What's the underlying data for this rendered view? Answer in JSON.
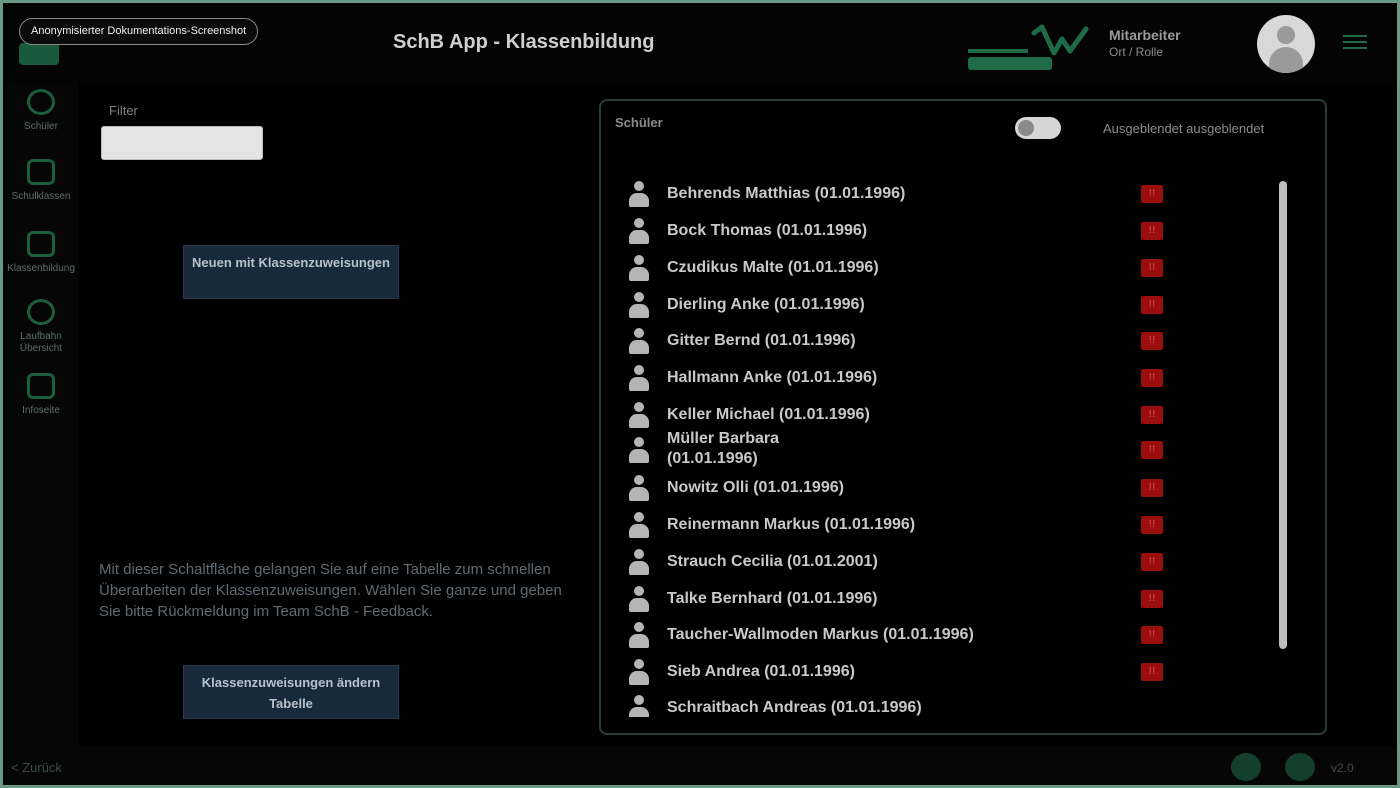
{
  "badge": "Anonymisierter Dokumentations-Screenshot",
  "header": {
    "title": "SchB App - Klassenbildung",
    "user_name": "Mitarbeiter",
    "user_role": "Ort / Rolle"
  },
  "sidebar": {
    "items": [
      {
        "label": "Schüler",
        "icon": "students-icon"
      },
      {
        "label": "Schulklassen",
        "icon": "classes-icon"
      },
      {
        "label": "Klassenbildung",
        "icon": "classbuild-icon"
      },
      {
        "label": "Laufbahn Übersicht",
        "icon": "overview-icon"
      },
      {
        "label": "Infoseite",
        "icon": "info-icon"
      }
    ]
  },
  "left": {
    "filter_label": "Filter",
    "filter_placeholder": "",
    "btn_new": "Neuen mit Klassenzuweisungen",
    "info_text": "Mit dieser Schaltfläche gelangen Sie auf eine Tabelle zum schnellen Überarbeiten der Klassenzuweisungen. Wählen Sie ganze und geben Sie bitte Rückmeldung im Team SchB - Feedback.",
    "btn_all": "Klassenzuweisungen ändern Tabelle"
  },
  "panel": {
    "title": "Schüler",
    "toggle_label": "Ausgeblendet ausgeblendet",
    "students": [
      {
        "name": "Behrends Matthias (01.01.1996)",
        "flag": "!!"
      },
      {
        "name": "Bock Thomas (01.01.1996)",
        "flag": "!!"
      },
      {
        "name": "Czudikus Malte (01.01.1996)",
        "flag": "!!"
      },
      {
        "name": "Dierling Anke (01.01.1996)",
        "flag": "!!"
      },
      {
        "name": "Gitter Bernd (01.01.1996)",
        "flag": "!!"
      },
      {
        "name": "Hallmann Anke (01.01.1996)",
        "flag": "!!"
      },
      {
        "name": "Keller Michael (01.01.1996)",
        "flag": "!!"
      },
      {
        "name": "Müller Barbara (01.01.1996)",
        "flag": "!!"
      },
      {
        "name": "Nowitz Olli (01.01.1996)",
        "flag": "!!"
      },
      {
        "name": "Reinermann Markus (01.01.1996)",
        "flag": "!!"
      },
      {
        "name": "Strauch Cecilia (01.01.2001)",
        "flag": "!!"
      },
      {
        "name": "Talke Bernhard (01.01.1996)",
        "flag": "!!"
      },
      {
        "name": "Taucher-Wallmoden Markus (01.01.1996)",
        "flag": "!!"
      },
      {
        "name": "Sieb Andrea (01.01.1996)",
        "flag": "!!"
      },
      {
        "name": "Schraitbach Andreas (01.01.1996)",
        "flag": ""
      }
    ]
  },
  "footer": {
    "back": "< Zurück",
    "version": "v2.0"
  }
}
